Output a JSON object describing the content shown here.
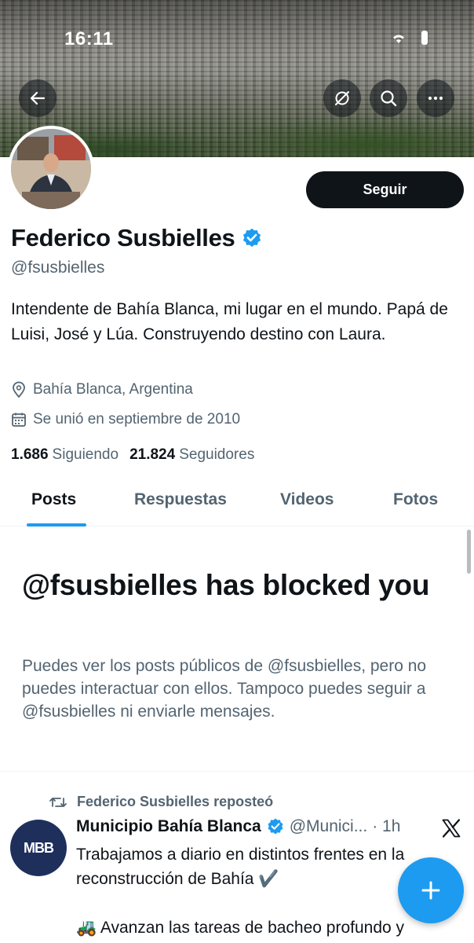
{
  "status_bar": {
    "time": "16:11"
  },
  "header": {
    "icons": [
      "back-arrow-icon",
      "grok-icon",
      "search-icon",
      "more-icon"
    ]
  },
  "profile": {
    "display_name": "Federico Susbielles",
    "verified": true,
    "handle": "@fsusbielles",
    "follow_label": "Seguir",
    "bio": "Intendente de Bahía Blanca, mi lugar en el mundo. Papá de Luisi, José y Lúa. Construyendo destino con Laura.",
    "location": "Bahía Blanca, Argentina",
    "joined": "Se unió en septiembre de 2010",
    "following_count": "1.686",
    "following_label": "Siguiendo",
    "followers_count": "21.824",
    "followers_label": "Seguidores"
  },
  "tabs": [
    {
      "label": "Posts",
      "active": true
    },
    {
      "label": "Respuestas",
      "active": false
    },
    {
      "label": "Videos",
      "active": false
    },
    {
      "label": "Fotos",
      "active": false
    }
  ],
  "blocked": {
    "title": "@fsusbielles has blocked you",
    "description": "Puedes ver los posts públicos de @fsusbielles, pero no puedes interactuar con ellos. Tampoco puedes seguir a @fsusbielles ni enviarle mensajes."
  },
  "tweet": {
    "repost_label": "Federico Susbielles reposteó",
    "avatar_text": "MBB",
    "author": "Municipio Bahía Blanca",
    "handle": "@Munici...",
    "time": "· 1h",
    "line1": "Trabajamos a diario en distintos frentes en la reconstrucción de Bahía ✔️",
    "line2": "🚜 Avanzan las tareas de bacheo profundo y"
  },
  "colors": {
    "accent": "#1d9bf0",
    "text": "#0f1419",
    "secondary": "#536471",
    "button": "#0f1419"
  }
}
